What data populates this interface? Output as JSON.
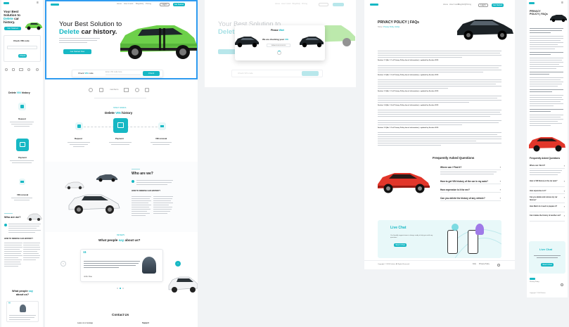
{
  "brand": {
    "accent": "#17b8c4",
    "selection": "#2e9bf0",
    "car_green": "#6dd04a",
    "car_red": "#e2362a"
  },
  "nav": {
    "home": "Home",
    "about": "How it work",
    "blog": "Blog/FAQ",
    "pricing": "Pricing",
    "login": "Log In",
    "signup": "Get Started"
  },
  "hero": {
    "title_line1": "Your Best Solution to",
    "title_delete": "Delete",
    "title_rest": " car history.",
    "subtitle": "We delete your car history from the auction sites and other platforms so buyers won't see the damages.",
    "cta": "Get Started Now",
    "vin_label": "Check",
    "vin_strong": "VIN",
    "vin_label_end": " code",
    "vin_placeholder": "Enter VIN code here",
    "vin_button": "Check"
  },
  "partners": [
    "copart",
    "iaai",
    "manheim",
    "autobid",
    "copart",
    "iaai"
  ],
  "how": {
    "eyebrow": "HOW IT WORKS",
    "title_pre": "Delete ",
    "title_vin": "VIN",
    "title_post": " history",
    "steps": [
      {
        "title": "Request",
        "desc": "Send us the VIN code of your car and request the deletion"
      },
      {
        "title": "Payment",
        "desc": "Pay securely for the service with any payment option"
      },
      {
        "title": "VIN removal",
        "desc": "We remove all photos and data of your car from the web"
      }
    ]
  },
  "who": {
    "eyebrow": "ABOUT US",
    "title": "Who are we?",
    "body": "We are a team of professionals who help car owners remove the history of their vehicles from auction sites.",
    "sub_title": "HOW TO REMOVE CAR HISTORY?"
  },
  "testimonials": {
    "eyebrow": "REVIEWS",
    "title_pre": "What people ",
    "title_say": "say",
    "title_post": " about us?",
    "quote": "Lorem ipsum dolor sit amet, consectetur adipiscing elit, sed do eiusmod tempor incididunt ut labore et dolore magna aliqua. Ut enim ad minim veniam.",
    "author": "John Doe"
  },
  "contact": {
    "title": "Contact Us",
    "message_label": "Leave us a message",
    "support_label": "Support"
  },
  "modal": {
    "title_pre": "Please ",
    "title_wait": "Wait",
    "checking_pre": "We are checking your ",
    "checking_vin": "VIN",
    "code": "WBA0000000000000"
  },
  "policy": {
    "title": "PRIVACY POLICY | FAQs",
    "breadcrumb_home": "Home",
    "breadcrumb_current": "Privacy Policy | FAQs",
    "sections": [
      "Section 1.1 (Art. 1.1 of Privacy Policy law of information) - updated by Section 2019",
      "Section 1.2 (Art. 1.2 of Privacy Policy law of information) - updated by Section 2019",
      "Section 1.3 (Art. 1.3 of Privacy Policy law of information) - updated by Section 2019",
      "Section 1.4 (Art. 1.4 of Privacy Policy law of information) - updated by Section 2019",
      "Section 1.5 (Art. 1.5 of Privacy Policy law of information) - updated by Section 2019"
    ]
  },
  "faq": {
    "title": "Frequently Asked Questions",
    "questions": [
      "Where can I Find it?",
      "How to get VIN history of the car in my auto?",
      "How expensive is it for me?",
      "Can you delete the history of any vehicle?"
    ]
  },
  "livechat": {
    "title": "Live Chat",
    "desc": "Our friendly support team is always ready to help you with any questions.",
    "button": "Start Chat"
  },
  "footer": {
    "copyright": "Copyright © 2024 Deleter. All Rights Reserved.",
    "faq": "FAQ",
    "privacy": "Privacy Policy"
  },
  "mobile": {
    "hero_title_pre": "Your Best Solution to ",
    "hero_delete": "Delete",
    "hero_title_post": " car history.",
    "cta": "Get Started",
    "check_label": "Check VIN code",
    "check_button": "Check",
    "how_title_pre": "Delete ",
    "how_vin": "VIN",
    "how_title_post": " history",
    "who_title": "Who are we?",
    "how_remove": "HOW TO REMOVE CAR HISTORY?",
    "say_title_pre": "What people ",
    "say_say": "say",
    "say_title_post": " about us?",
    "policy_title": "PRIVACY POLICY | FAQs",
    "faq_title": "Frequently Asked Questions",
    "faq_questions": [
      "Where can I find it?",
      "How is VIN history in the car auto?",
      "How expensive is it?",
      "Can you delete and remove my car history?",
      "How Much do I need to prepare it?",
      "Can I delete the history of another car?"
    ],
    "livechat": "Live Chat",
    "livechat_button": "Start Chat",
    "footer_privacy": "Privacy Policy",
    "copyright": "Copyright © 2024 Deleter"
  }
}
